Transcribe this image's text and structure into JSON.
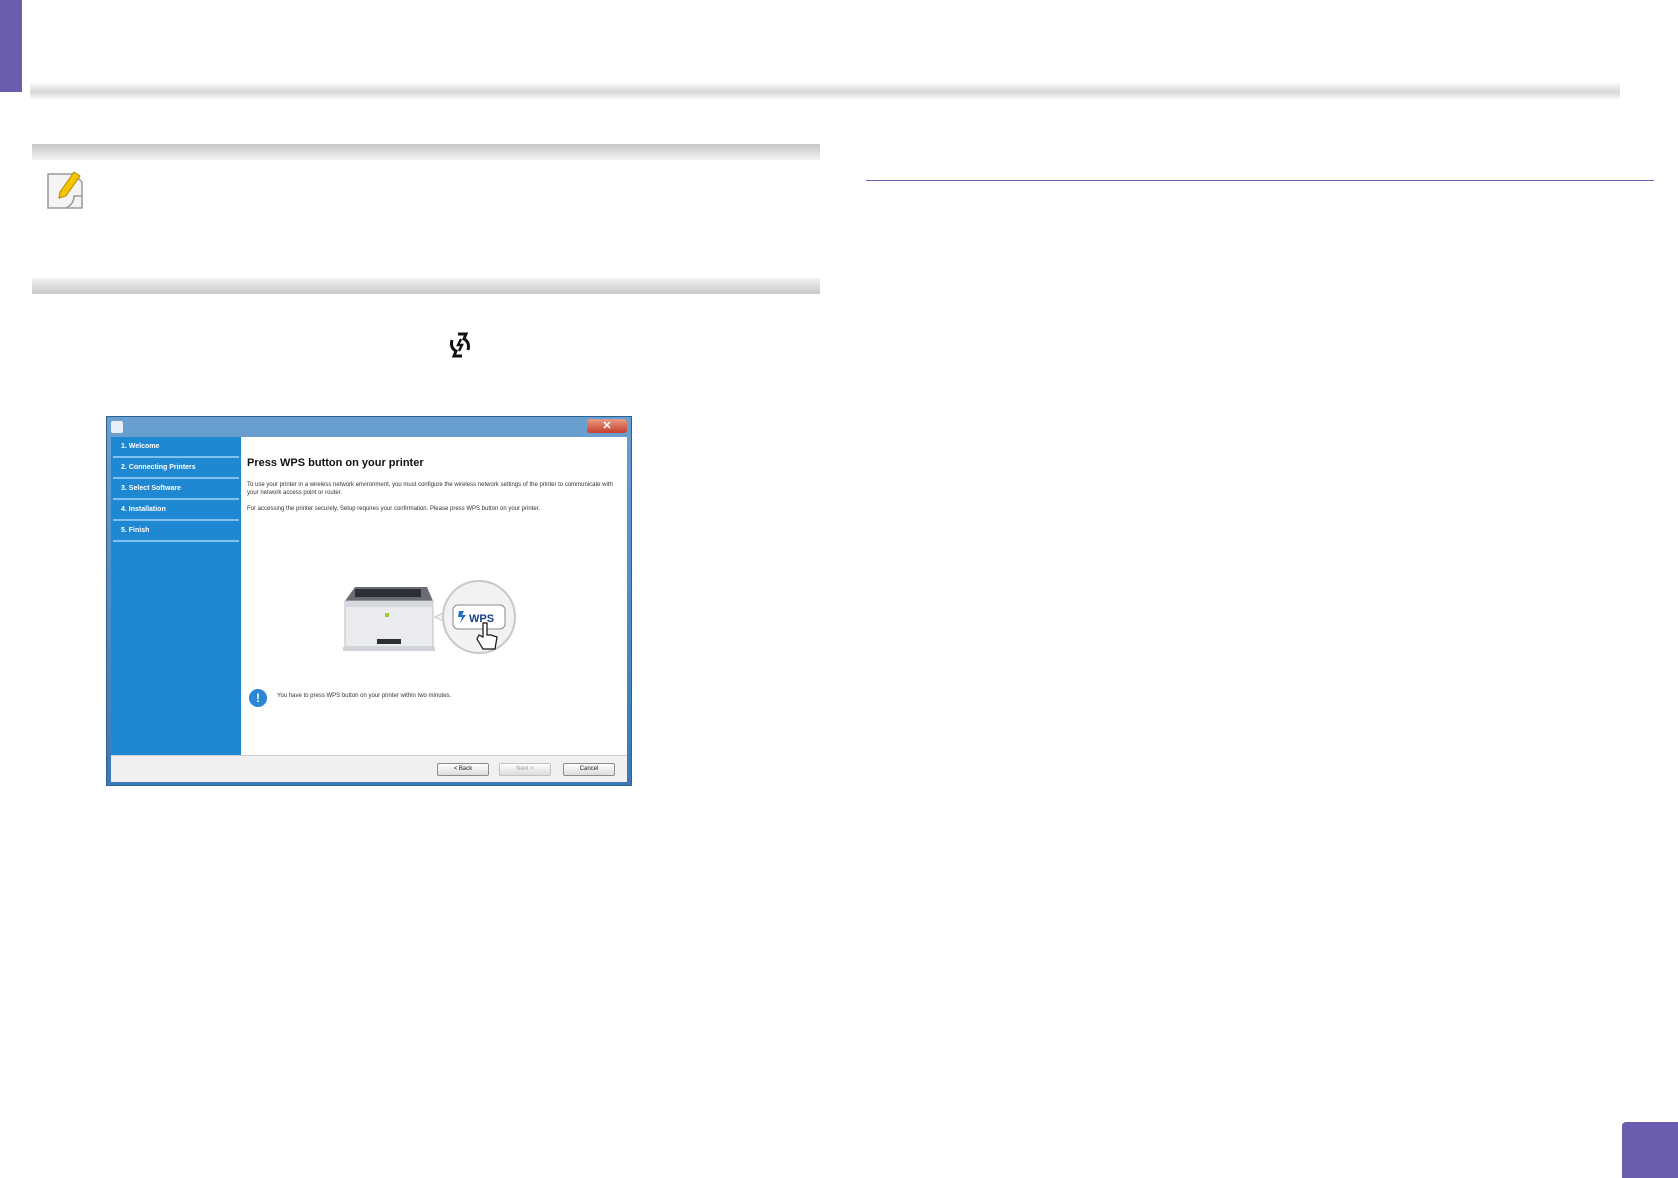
{
  "colors": {
    "accent": "#6a5cae",
    "dialog_sidebar": "#1e88d2",
    "info_blue": "#2b86d6"
  },
  "icons": [
    "note-pencil-icon",
    "wps-icon",
    "info-icon",
    "close-icon",
    "printer-illustration",
    "hand-cursor-icon"
  ],
  "dialog": {
    "close_glyph": "✕",
    "steps": [
      "1. Welcome",
      "2. Connecting Printers",
      "3. Select Software",
      "4. Installation",
      "5. Finish"
    ],
    "heading": "Press WPS button on your printer",
    "paragraph1": "To use your printer in a wireless network environment, you must configure the wireless network settings of the printer to communicate with your network access point or router.",
    "paragraph2": "For accessing the printer securely, Setup requires your confirmation. Please press WPS button on your printer.",
    "wps_label": "WPS",
    "info_glyph": "!",
    "info_text": "You have to press WPS button on your printer within two minutes.",
    "buttons": {
      "back": "< Back",
      "next": "Next >",
      "cancel": "Cancel"
    }
  }
}
